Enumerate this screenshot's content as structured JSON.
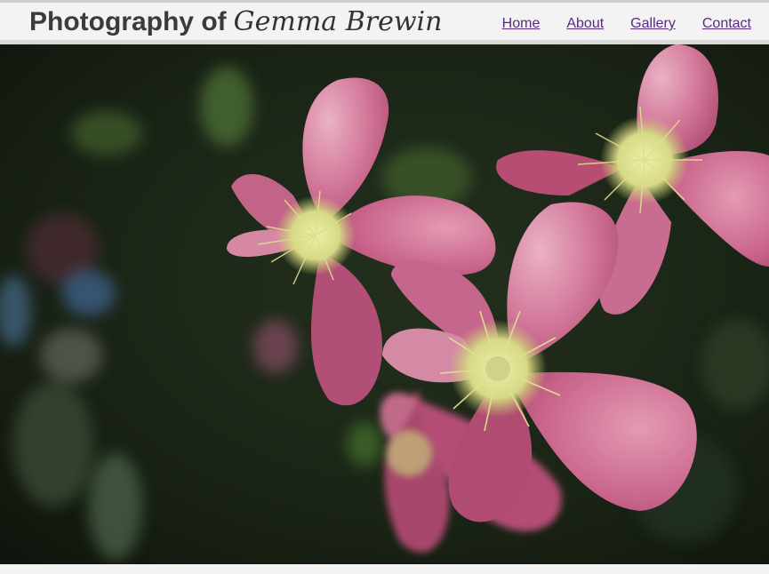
{
  "header": {
    "title_prefix": "Photography of",
    "title_name": "Gemma Brewin"
  },
  "nav": {
    "items": [
      "Home",
      "About",
      "Gallery",
      "Contact"
    ]
  },
  "hero": {
    "subject": "pink-clematis-flowers-photo",
    "colors": {
      "petal": "#c45a80",
      "petal_light": "#e8a6bd",
      "stamen": "#d9dc8a",
      "background": "#1a2315"
    }
  }
}
